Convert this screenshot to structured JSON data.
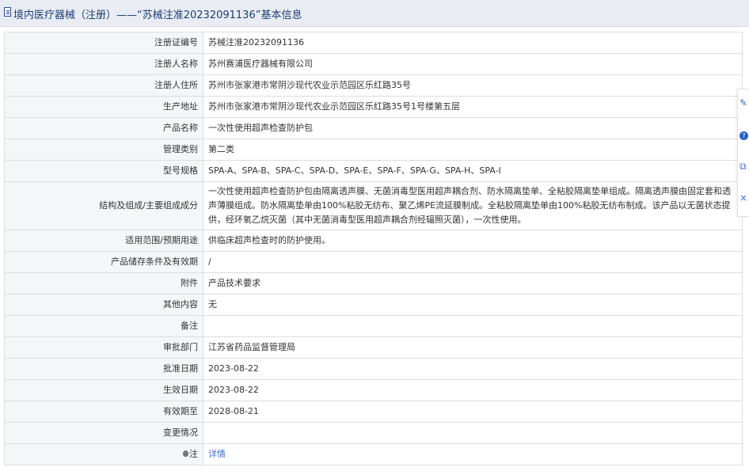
{
  "header": {
    "title": "境内医疗器械（注册）——“苏械注准20232091136”基本信息"
  },
  "rows": [
    {
      "label": "注册证编号",
      "value": "苏械注准20232091136"
    },
    {
      "label": "注册人名称",
      "value": "苏州赛浦医疗器械有限公司"
    },
    {
      "label": "注册人住所",
      "value": "苏州市张家港市常阴沙现代农业示范园区乐红路35号"
    },
    {
      "label": "生产地址",
      "value": "苏州市张家港市常阴沙现代农业示范园区乐红路35号1号楼第五层"
    },
    {
      "label": "产品名称",
      "value": "一次性使用超声检查防护包"
    },
    {
      "label": "管理类别",
      "value": "第二类"
    },
    {
      "label": "型号规格",
      "value": "SPA-A、SPA-B、SPA-C、SPA-D、SPA-E、SPA-F、SPA-G、SPA-H、SPA-I"
    },
    {
      "label": "结构及组成/主要组成成分",
      "value": "一次性使用超声检查防护包由隔离透声膜、无菌消毒型医用超声耦合剂、防水隔离垫单、全粘胶隔离垫单组成。隔离透声膜由固定套和透声薄膜组成。防水隔离垫单由100%粘胶无纺布、聚乙烯PE流延膜制成。全粘胶隔离垫单由100%粘胶无纺布制成。该产品以无菌状态提供，经环氧乙烷灭菌（其中无菌消毒型医用超声耦合剂经辐照灭菌），一次性使用。"
    },
    {
      "label": "适用范围/预期用途",
      "value": "供临床超声检查时的防护使用。"
    },
    {
      "label": "产品储存条件及有效期",
      "value": "/"
    },
    {
      "label": "附件",
      "value": "产品技术要求"
    },
    {
      "label": "其他内容",
      "value": "无"
    },
    {
      "label": "备注",
      "value": ""
    },
    {
      "label": "审批部门",
      "value": "江苏省药品监督管理局"
    },
    {
      "label": "批准日期",
      "value": "2023-08-22"
    },
    {
      "label": "生效日期",
      "value": "2023-08-22"
    },
    {
      "label": "有效期至",
      "value": "2028-08-21"
    },
    {
      "label": "变更情况",
      "value": ""
    }
  ],
  "note": {
    "label": "注",
    "link_text": "详情",
    "icon": "bulb-icon"
  },
  "side_tools": [
    {
      "icon": "edit-icon",
      "glyph": "✎"
    },
    {
      "icon": "help-icon",
      "glyph": "?"
    },
    {
      "icon": "copy-icon",
      "glyph": "⧉"
    },
    {
      "icon": "close-icon",
      "glyph": "×"
    }
  ],
  "colors": {
    "title": "#1c3d74",
    "link": "#3a6fd1",
    "label_bg": "#f5f6f8",
    "header_bg": "#e9edf3"
  }
}
